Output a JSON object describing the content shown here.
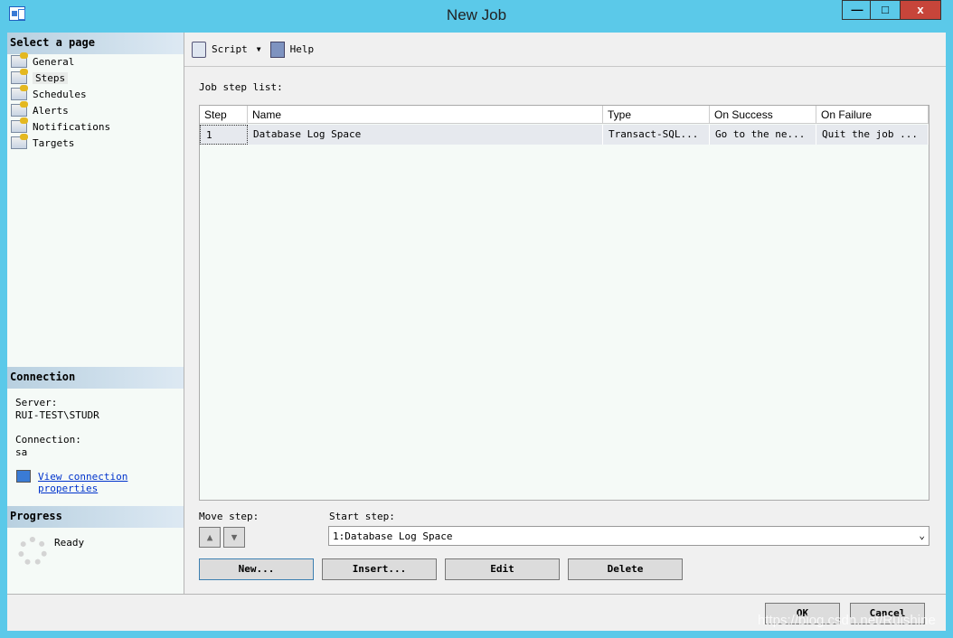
{
  "window": {
    "title": "New Job",
    "minimize": "—",
    "maximize": "□",
    "close": "x"
  },
  "left": {
    "select_header": "Select a page",
    "pages": [
      {
        "label": "General"
      },
      {
        "label": "Steps"
      },
      {
        "label": "Schedules"
      },
      {
        "label": "Alerts"
      },
      {
        "label": "Notifications"
      },
      {
        "label": "Targets"
      }
    ],
    "selected": "Steps",
    "connection_header": "Connection",
    "server_label": "Server:",
    "server_value": "RUI-TEST\\STUDR",
    "connection_label": "Connection:",
    "connection_value": "sa",
    "view_link_1": "View connection",
    "view_link_2": "properties",
    "progress_header": "Progress",
    "progress_status": "Ready"
  },
  "toolbar": {
    "script": "Script",
    "help": "Help"
  },
  "main": {
    "job_step_list_label": "Job step list:",
    "columns": [
      "Step",
      "Name",
      "Type",
      "On Success",
      "On Failure"
    ],
    "rows": [
      [
        "1",
        "Database Log Space",
        "Transact-SQL...",
        "Go to the ne...",
        "Quit the job ..."
      ]
    ],
    "move_step_label": "Move step:",
    "start_step_label": "Start step:",
    "start_step_value": "1:Database Log Space",
    "buttons": {
      "new": "New...",
      "insert": "Insert...",
      "edit": "Edit",
      "delete": "Delete"
    }
  },
  "footer": {
    "ok": "OK",
    "cancel": "Cancel"
  },
  "watermark": "https://blog.csdn.net/Ruishine"
}
